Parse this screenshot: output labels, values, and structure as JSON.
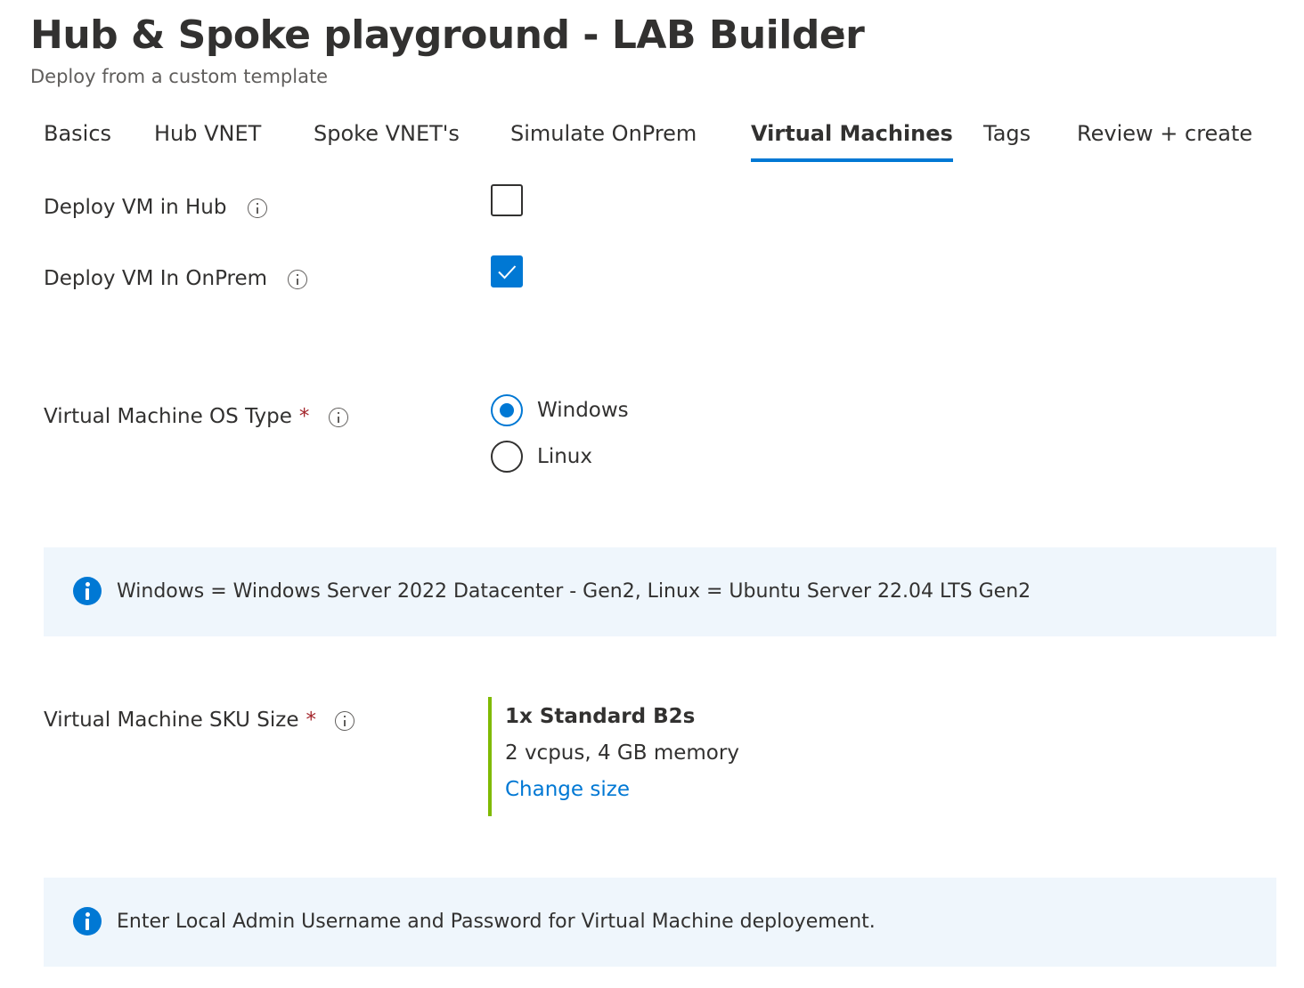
{
  "header": {
    "title": "Hub & Spoke playground - LAB Builder",
    "more_label": "···",
    "subtitle": "Deploy from a custom template"
  },
  "tabs": [
    {
      "label": "Basics",
      "active": false
    },
    {
      "label": "Hub VNET",
      "active": false
    },
    {
      "label": "Spoke VNET's",
      "active": false
    },
    {
      "label": "Simulate OnPrem",
      "active": false
    },
    {
      "label": "Virtual Machines",
      "active": true
    },
    {
      "label": "Tags",
      "active": false
    },
    {
      "label": "Review + create",
      "active": false
    }
  ],
  "fields": {
    "deploy_vm_hub": {
      "label": "Deploy VM in Hub",
      "checked": false
    },
    "deploy_vm_onprem": {
      "label": "Deploy VM In OnPrem",
      "checked": true
    },
    "os_type": {
      "label": "Virtual Machine OS Type",
      "required_mark": "*",
      "options": [
        {
          "label": "Windows",
          "selected": true
        },
        {
          "label": "Linux",
          "selected": false
        }
      ]
    },
    "sku_size": {
      "label": "Virtual Machine SKU Size",
      "required_mark": "*",
      "name": "1x Standard B2s",
      "detail": "2 vcpus, 4 GB memory",
      "change_link": "Change size"
    }
  },
  "banners": {
    "os_info": "Windows = Windows Server 2022 Datacenter - Gen2, Linux = Ubuntu Server 22.04 LTS Gen2",
    "admin_info": "Enter Local Admin Username and Password for Virtual Machine deployement."
  },
  "colors": {
    "accent": "#0078d4",
    "required": "#a4262c",
    "sku_bar": "#7fba00",
    "banner_bg": "#eff6fc"
  },
  "icons": {
    "info": "info-icon",
    "banner_info": "info-filled-icon",
    "check": "checkmark-icon"
  }
}
